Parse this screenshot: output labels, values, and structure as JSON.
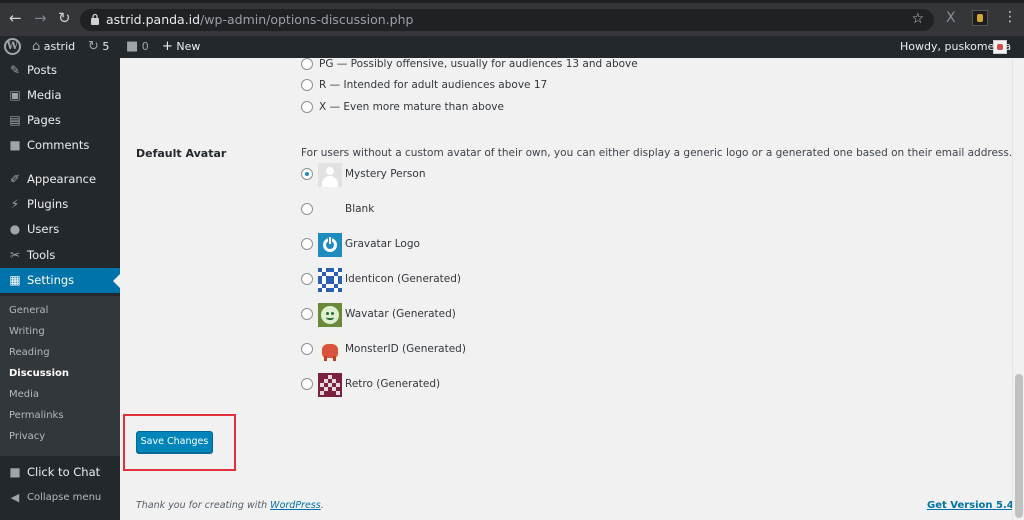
{
  "browser": {
    "url_host": "astrid.panda.id",
    "url_path": "/wp-admin/options-discussion.php"
  },
  "adminbar": {
    "site_name": "astrid",
    "updates_count": "5",
    "comments_count": "0",
    "new_label": "New",
    "howdy": "Howdy, puskomedia"
  },
  "sidebar": {
    "items": [
      {
        "label": "Posts",
        "icon": "pin-icon"
      },
      {
        "label": "Media",
        "icon": "media-icon"
      },
      {
        "label": "Pages",
        "icon": "pages-icon"
      },
      {
        "label": "Comments",
        "icon": "comments-icon"
      },
      {
        "label": "Appearance",
        "icon": "appearance-icon"
      },
      {
        "label": "Plugins",
        "icon": "plugins-icon"
      },
      {
        "label": "Users",
        "icon": "users-icon"
      },
      {
        "label": "Tools",
        "icon": "tools-icon"
      },
      {
        "label": "Settings",
        "icon": "settings-icon"
      }
    ],
    "submenu": [
      "General",
      "Writing",
      "Reading",
      "Discussion",
      "Media",
      "Permalinks",
      "Privacy"
    ],
    "current_submenu": "Discussion",
    "click_to_chat": "Click to Chat",
    "collapse": "Collapse menu"
  },
  "ratings": [
    "PG — Possibly offensive, usually for audiences 13 and above",
    "R — Intended for adult audiences above 17",
    "X — Even more mature than above"
  ],
  "default_avatar": {
    "title": "Default Avatar",
    "description": "For users without a custom avatar of their own, you can either display a generic logo or a generated one based on their email address.",
    "options": [
      {
        "label": "Mystery Person",
        "selected": true
      },
      {
        "label": "Blank",
        "selected": false
      },
      {
        "label": "Gravatar Logo",
        "selected": false
      },
      {
        "label": "Identicon (Generated)",
        "selected": false
      },
      {
        "label": "Wavatar (Generated)",
        "selected": false
      },
      {
        "label": "MonsterID (Generated)",
        "selected": false
      },
      {
        "label": "Retro (Generated)",
        "selected": false
      }
    ]
  },
  "save_button": "Save Changes",
  "footer": {
    "thanks_prefix": "Thank you for creating with",
    "wordpress_link": "WordPress",
    "thanks_suffix": ".",
    "get_version": "Get Version 5.4"
  },
  "colors": {
    "accent": "#0073aa",
    "admin_dark": "#23282d",
    "highlight_box": "#e0303a"
  }
}
